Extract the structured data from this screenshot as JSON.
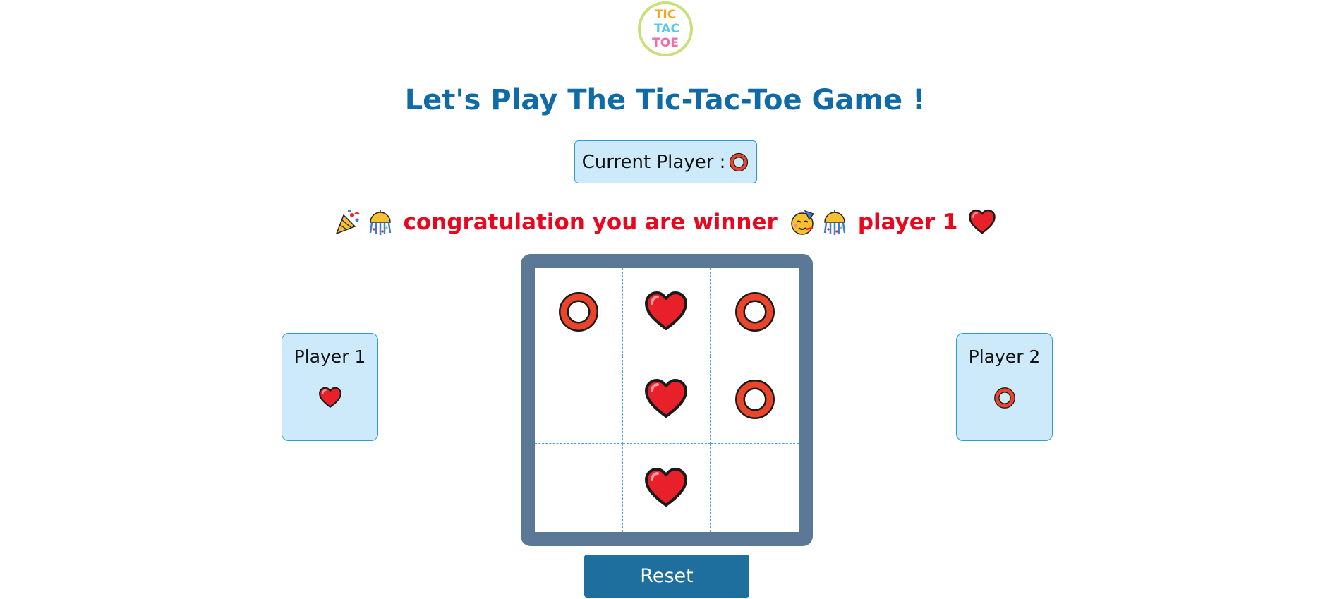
{
  "logo": {
    "line1": "TIC",
    "line2": "TAC",
    "line3": "TOE"
  },
  "title": "Let's Play The Tic-Tac-Toe Game !",
  "current_player": {
    "label": "Current Player :",
    "icon": "ring-icon"
  },
  "winner_message": {
    "text": "congratulation you are winner",
    "player": "player 1",
    "icons": [
      "party-popper-icon",
      "confetti-ball-icon",
      "partying-face-icon",
      "confetti-ball-icon",
      "heart-icon"
    ]
  },
  "board": {
    "cells": [
      "O",
      "H",
      "O",
      "",
      "H",
      "O",
      "",
      "H",
      ""
    ],
    "legend": {
      "H": "heart-icon",
      "O": "ring-icon"
    }
  },
  "players": [
    {
      "label": "Player 1",
      "icon": "heart-icon"
    },
    {
      "label": "Player 2",
      "icon": "ring-icon"
    }
  ],
  "reset_label": "Reset",
  "colors": {
    "title": "#0f6ba8",
    "winner": "#e8071f",
    "panel_bg": "#cdeafb",
    "panel_border": "#2f9ad8",
    "board_frame": "#5b7996",
    "reset_bg": "#1e6e9e",
    "heart": "#e8202a",
    "ring": "#e8452a"
  }
}
